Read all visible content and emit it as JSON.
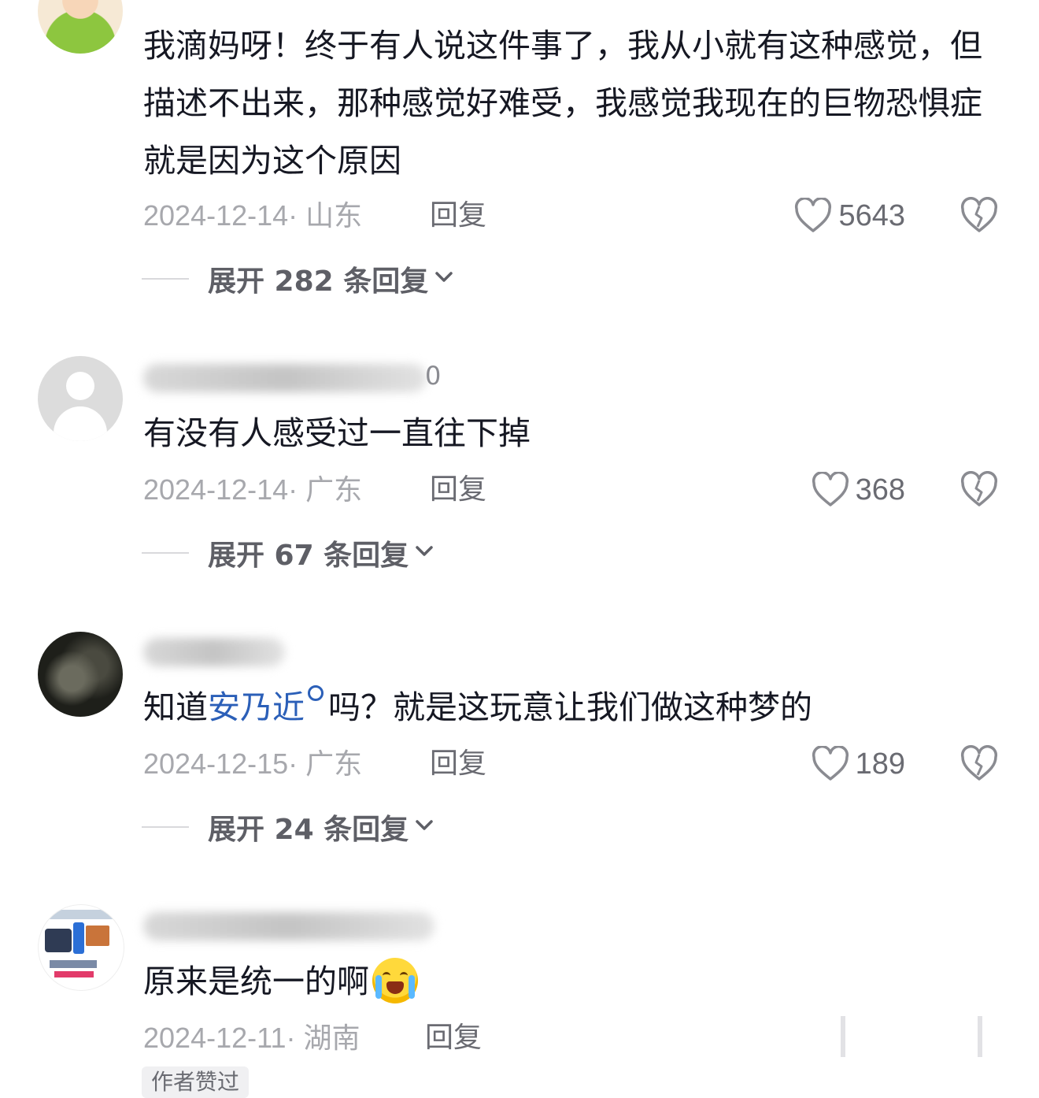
{
  "comments": [
    {
      "username_tail": "",
      "content": "我滴妈呀！终于有人说这件事了，我从小就有这种感觉，但描述不出来，那种感觉好难受，我感觉我现在的巨物恐惧症就是因为这个原因",
      "date": "2024-12-14",
      "location": "山东",
      "date_location": "2024-12-14· 山东",
      "reply_label": "回复",
      "likes": "5643",
      "expand_label": "展开 282 条回复"
    },
    {
      "username_tail": "0",
      "content": "有没有人感受过一直往下掉",
      "date": "2024-12-14",
      "location": "广东",
      "date_location": "2024-12-14· 广东",
      "reply_label": "回复",
      "likes": "368",
      "expand_label": "展开 67 条回复"
    },
    {
      "username_tail": "",
      "content_before": "知道",
      "mention": "安乃近",
      "content_after": "吗？就是这玩意让我们做这种梦的",
      "date": "2024-12-15",
      "location": "广东",
      "date_location": "2024-12-15· 广东",
      "reply_label": "回复",
      "likes": "189",
      "expand_label": "展开 24 条回复"
    },
    {
      "username_tail": "",
      "content": "原来是统一的啊",
      "emoji": "crying-laughing-emoji",
      "date": "2024-12-11",
      "location": "湖南",
      "date_location": "2024-12-11· 湖南",
      "reply_label": "回复",
      "badge": "作者赞过"
    }
  ],
  "icons": {
    "like": "heart-outline-icon",
    "dislike": "broken-heart-icon",
    "expand": "chevron-down-icon",
    "mention": "search-icon"
  },
  "colors": {
    "text": "#161823",
    "meta": "#a7a8ad",
    "action": "#6a6b72",
    "mention": "#2b5fb8"
  }
}
